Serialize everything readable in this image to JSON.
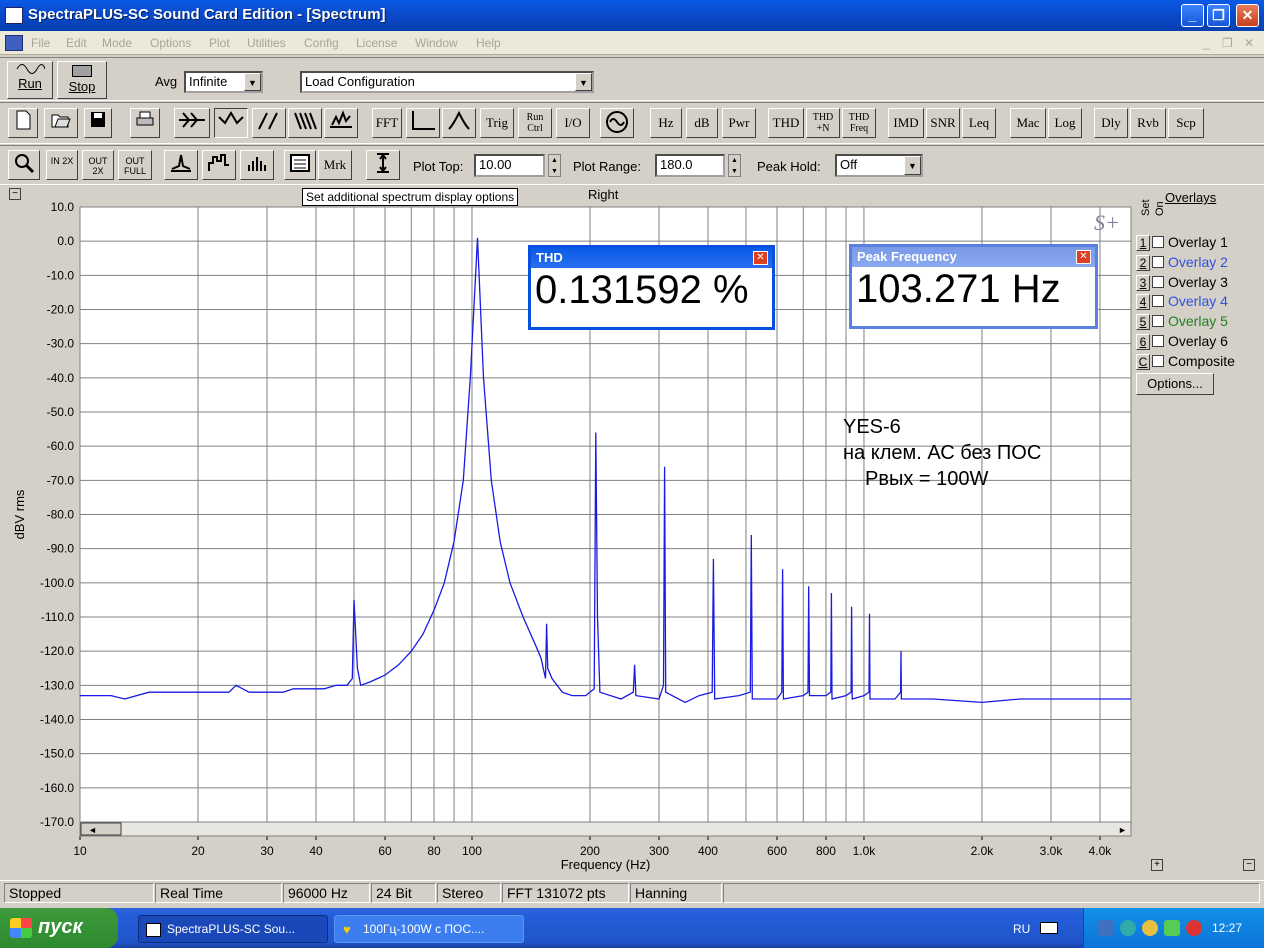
{
  "window": {
    "title": "SpectraPLUS-SC Sound Card Edition - [Spectrum]"
  },
  "menu": [
    "File",
    "Edit",
    "Mode",
    "Options",
    "Plot",
    "Utilities",
    "Config",
    "License",
    "Window",
    "Help"
  ],
  "toolbar1": {
    "run": "Run",
    "stop": "Stop",
    "avg_label": "Avg",
    "avg_value": "Infinite",
    "config_value": "Load Configuration"
  },
  "toolbar2": [
    "FFT",
    "Trig",
    "Run Ctrl",
    "I/O",
    "Hz",
    "dB",
    "Pwr",
    "THD",
    "THD +N",
    "THD Freq",
    "IMD",
    "SNR",
    "Leq",
    "Mac",
    "Log",
    "Dly",
    "Rvb",
    "Scp"
  ],
  "toolbar3": {
    "zoom_in": "IN 2X",
    "zoom_out": "OUT 2X",
    "zoom_full": "OUT FULL",
    "marker": "Mrk",
    "plot_top_label": "Plot Top:",
    "plot_top_value": "10.00",
    "plot_range_label": "Plot Range:",
    "plot_range_value": "180.0",
    "peak_hold_label": "Peak Hold:",
    "peak_hold_value": "Off"
  },
  "tooltip": "Set additional spectrum display options",
  "channel": "Right",
  "thd": {
    "title": "THD",
    "value": "0.131592 %"
  },
  "peak": {
    "title": "Peak Frequency",
    "value": "103.271 Hz"
  },
  "annotation": [
    "YES-6",
    "на клем. АС без ПОС",
    "Рвых = 100W"
  ],
  "logo": "S+",
  "overlays": {
    "title": "Overlays",
    "set_label": "Set",
    "on_label": "On",
    "items": [
      {
        "key": "1",
        "label": "Overlay 1",
        "color": "#000000"
      },
      {
        "key": "2",
        "label": "Overlay 2",
        "color": "#3050e0"
      },
      {
        "key": "3",
        "label": "Overlay 3",
        "color": "#000000"
      },
      {
        "key": "4",
        "label": "Overlay 4",
        "color": "#3050e0"
      },
      {
        "key": "5",
        "label": "Overlay 5",
        "color": "#208020"
      },
      {
        "key": "6",
        "label": "Overlay 6",
        "color": "#000000"
      },
      {
        "key": "C",
        "label": "Composite",
        "color": "#000000"
      }
    ],
    "options": "Options..."
  },
  "status": [
    "Stopped",
    "Real Time",
    "96000 Hz",
    "24 Bit",
    "Stereo",
    "FFT 131072 pts",
    "Hanning"
  ],
  "taskbar": {
    "start": "пуск",
    "task1": "SpectraPLUS-SC Sou...",
    "task2": "100Гц-100W с ПОС....",
    "lang": "RU",
    "clock": "12:27"
  },
  "chart_data": {
    "type": "line",
    "xlabel": "Frequency (Hz)",
    "ylabel": "dBV rms",
    "xscale": "log",
    "xlim": [
      10,
      4800
    ],
    "ylim": [
      -170,
      10
    ],
    "yticks": [
      10,
      0,
      -10,
      -20,
      -30,
      -40,
      -50,
      -60,
      -70,
      -80,
      -90,
      -100,
      -110,
      -120,
      -130,
      -140,
      -150,
      -160,
      -170
    ],
    "xticks": [
      {
        "v": 10,
        "t": "10"
      },
      {
        "v": 20,
        "t": "20"
      },
      {
        "v": 30,
        "t": "30"
      },
      {
        "v": 40,
        "t": "40"
      },
      {
        "v": 60,
        "t": "60"
      },
      {
        "v": 80,
        "t": "80"
      },
      {
        "v": 100,
        "t": "100"
      },
      {
        "v": 200,
        "t": "200"
      },
      {
        "v": 300,
        "t": "300"
      },
      {
        "v": 400,
        "t": "400"
      },
      {
        "v": 600,
        "t": "600"
      },
      {
        "v": 800,
        "t": "800"
      },
      {
        "v": 1000,
        "t": "1.0k"
      },
      {
        "v": 2000,
        "t": "2.0k"
      },
      {
        "v": 3000,
        "t": "3.0k"
      },
      {
        "v": 4000,
        "t": "4.0k"
      }
    ],
    "color": "#1a1ae6",
    "series": [
      {
        "name": "Right",
        "points": [
          [
            10,
            -133
          ],
          [
            12,
            -133
          ],
          [
            13,
            -134
          ],
          [
            15,
            -132
          ],
          [
            17,
            -132
          ],
          [
            18,
            -132
          ],
          [
            20,
            -132
          ],
          [
            22,
            -132
          ],
          [
            24,
            -132
          ],
          [
            25,
            -130
          ],
          [
            27,
            -132
          ],
          [
            30,
            -132
          ],
          [
            33,
            -132
          ],
          [
            35,
            -131
          ],
          [
            37,
            -131
          ],
          [
            40,
            -131
          ],
          [
            42,
            -131
          ],
          [
            45,
            -130
          ],
          [
            48,
            -130
          ],
          [
            49.5,
            -128
          ],
          [
            50,
            -105
          ],
          [
            50.5,
            -115
          ],
          [
            51,
            -125
          ],
          [
            52,
            -130
          ],
          [
            55,
            -129
          ],
          [
            60,
            -127
          ],
          [
            65,
            -124
          ],
          [
            70,
            -120
          ],
          [
            75,
            -115
          ],
          [
            80,
            -108
          ],
          [
            85,
            -100
          ],
          [
            90,
            -88
          ],
          [
            95,
            -70
          ],
          [
            99,
            -40
          ],
          [
            103.3,
            1
          ],
          [
            107,
            -40
          ],
          [
            112,
            -70
          ],
          [
            118,
            -88
          ],
          [
            125,
            -100
          ],
          [
            135,
            -110
          ],
          [
            145,
            -118
          ],
          [
            150,
            -122
          ],
          [
            154,
            -128
          ],
          [
            155,
            -112
          ],
          [
            156,
            -125
          ],
          [
            160,
            -128
          ],
          [
            170,
            -132
          ],
          [
            180,
            -133
          ],
          [
            195,
            -133
          ],
          [
            205,
            -131
          ],
          [
            207,
            -56
          ],
          [
            209,
            -110
          ],
          [
            212,
            -132
          ],
          [
            240,
            -134
          ],
          [
            258,
            -132
          ],
          [
            260,
            -124
          ],
          [
            262,
            -133
          ],
          [
            300,
            -134
          ],
          [
            308,
            -130
          ],
          [
            310,
            -66
          ],
          [
            312,
            -132
          ],
          [
            350,
            -135
          ],
          [
            380,
            -133
          ],
          [
            410,
            -132
          ],
          [
            413,
            -93
          ],
          [
            416,
            -134
          ],
          [
            480,
            -133
          ],
          [
            513,
            -132
          ],
          [
            516,
            -86
          ],
          [
            519,
            -134
          ],
          [
            550,
            -134
          ],
          [
            600,
            -134
          ],
          [
            617,
            -132
          ],
          [
            620,
            -96
          ],
          [
            623,
            -134
          ],
          [
            700,
            -133
          ],
          [
            720,
            -132
          ],
          [
            723,
            -101
          ],
          [
            726,
            -133
          ],
          [
            800,
            -133
          ],
          [
            823,
            -132
          ],
          [
            826,
            -103
          ],
          [
            829,
            -134
          ],
          [
            900,
            -133
          ],
          [
            927,
            -132
          ],
          [
            930,
            -107
          ],
          [
            933,
            -134
          ],
          [
            1000,
            -133
          ],
          [
            1030,
            -132
          ],
          [
            1033,
            -109
          ],
          [
            1036,
            -134
          ],
          [
            1200,
            -134
          ],
          [
            1240,
            -132
          ],
          [
            1243,
            -120
          ],
          [
            1246,
            -134
          ],
          [
            1500,
            -134
          ],
          [
            2000,
            -135
          ],
          [
            2500,
            -134
          ],
          [
            3000,
            -134
          ],
          [
            3500,
            -134
          ],
          [
            4000,
            -134
          ],
          [
            4800,
            -134
          ]
        ]
      }
    ]
  }
}
